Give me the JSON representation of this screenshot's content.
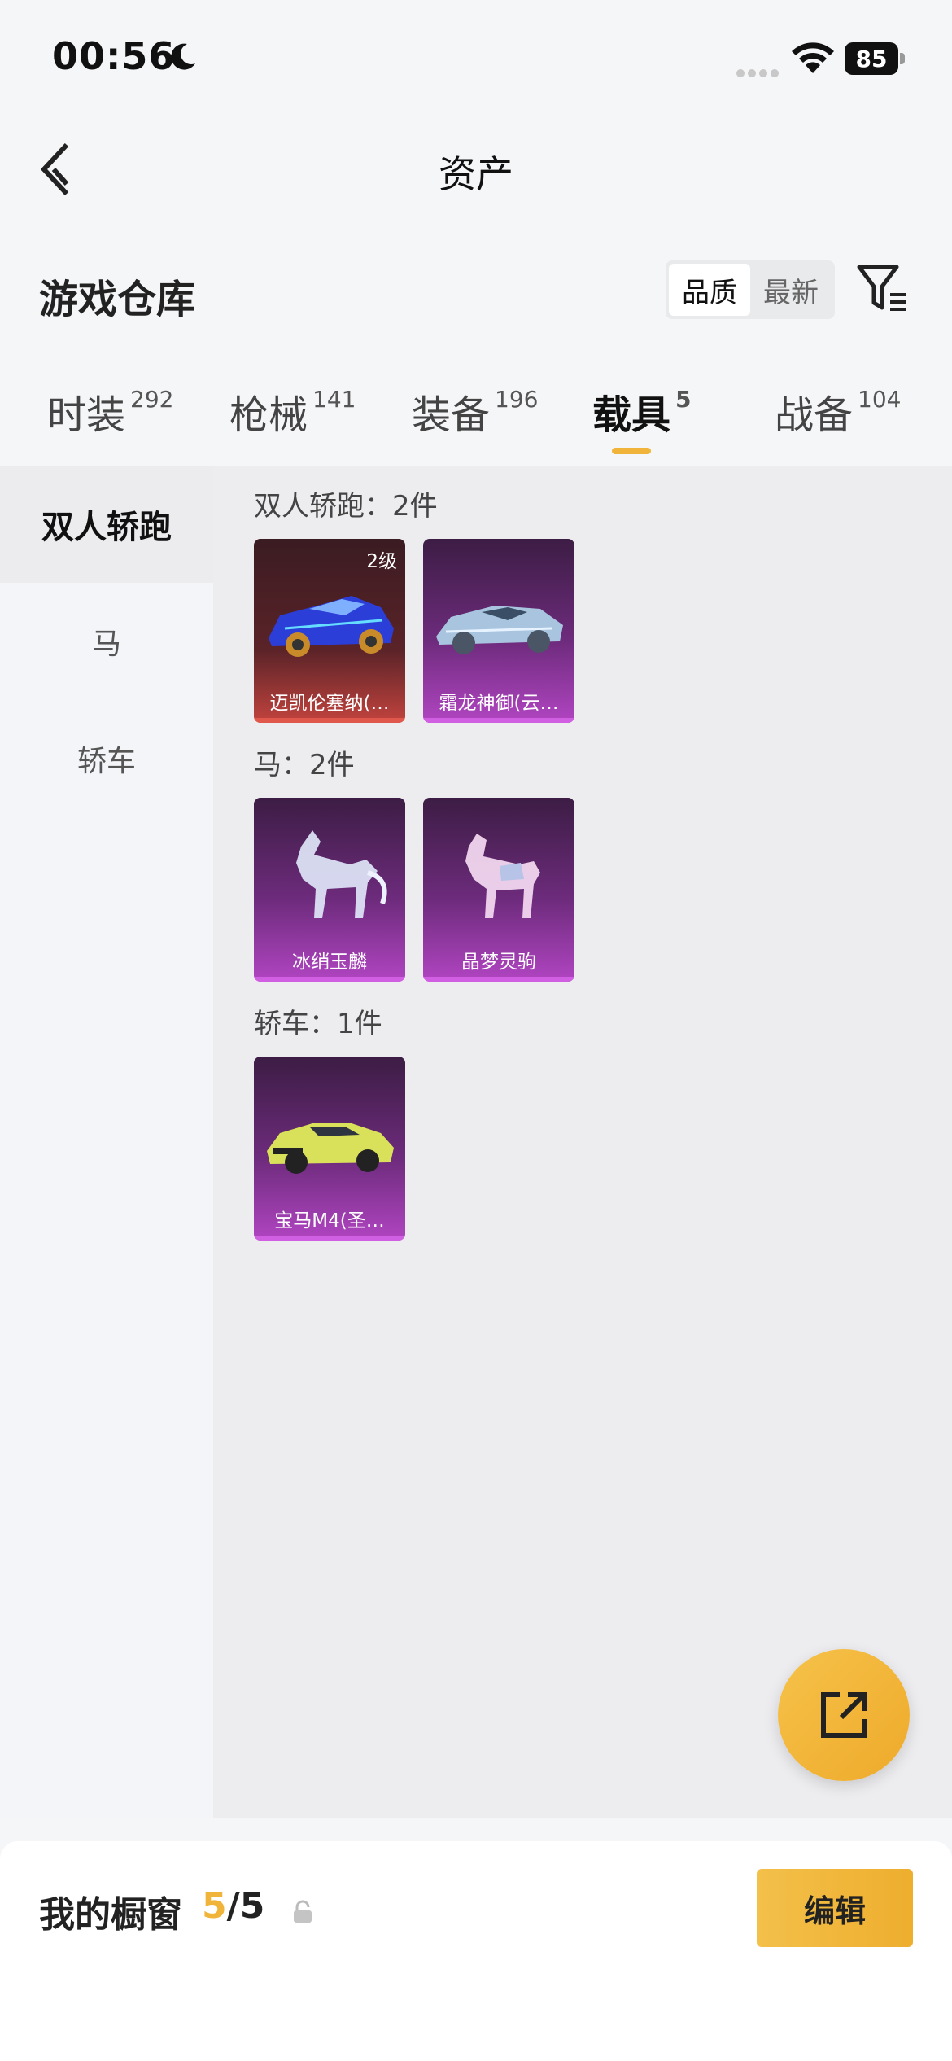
{
  "status_bar": {
    "time": "00:56",
    "battery": "85"
  },
  "nav": {
    "title": "资产"
  },
  "header": {
    "title": "游戏仓库",
    "sort_options": [
      "品质",
      "最新"
    ],
    "active_sort": "品质"
  },
  "tabs": [
    {
      "label": "时装",
      "count": "292"
    },
    {
      "label": "枪械",
      "count": "141"
    },
    {
      "label": "装备",
      "count": "196"
    },
    {
      "label": "载具",
      "count": "5"
    },
    {
      "label": "战备",
      "count": "104"
    }
  ],
  "active_tab": "载具",
  "sidebar": [
    {
      "label": "双人轿跑",
      "active": true
    },
    {
      "label": "马",
      "active": false
    },
    {
      "label": "轿车",
      "active": false
    }
  ],
  "groups": [
    {
      "label": "双人轿跑：2件",
      "items": [
        {
          "name": "迈凯伦塞纳(…",
          "level": "2级",
          "rarity": "red"
        },
        {
          "name": "霜龙神御(云…",
          "rarity": "purple"
        }
      ]
    },
    {
      "label": "马：2件",
      "items": [
        {
          "name": "冰绡玉麟",
          "rarity": "purple"
        },
        {
          "name": "晶梦灵驹",
          "rarity": "purple"
        }
      ]
    },
    {
      "label": "轿车：1件",
      "items": [
        {
          "name": "宝马M4(圣…",
          "rarity": "purple"
        }
      ]
    }
  ],
  "showcase": {
    "label": "我的橱窗",
    "current": "5",
    "total": "/5",
    "edit_label": "编辑"
  },
  "colors": {
    "accent": "#f0b43a",
    "red_rarity": "#e0574c",
    "purple_rarity": "#d05fe2"
  }
}
